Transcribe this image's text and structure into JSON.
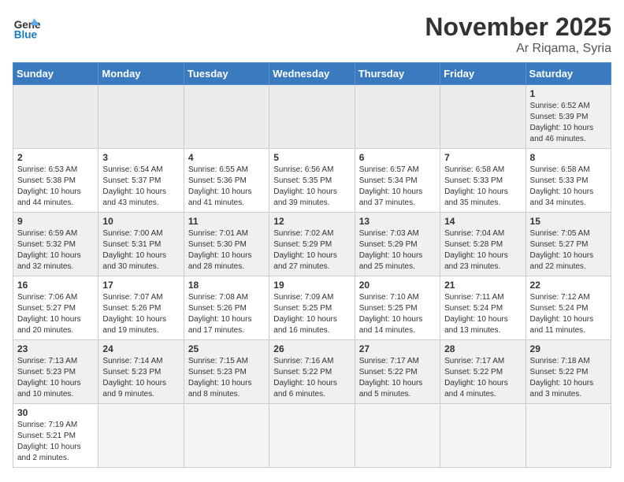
{
  "logo": {
    "text_general": "General",
    "text_blue": "Blue"
  },
  "title": "November 2025",
  "subtitle": "Ar Riqama, Syria",
  "weekdays": [
    "Sunday",
    "Monday",
    "Tuesday",
    "Wednesday",
    "Thursday",
    "Friday",
    "Saturday"
  ],
  "weeks": [
    [
      {
        "day": "",
        "info": ""
      },
      {
        "day": "",
        "info": ""
      },
      {
        "day": "",
        "info": ""
      },
      {
        "day": "",
        "info": ""
      },
      {
        "day": "",
        "info": ""
      },
      {
        "day": "",
        "info": ""
      },
      {
        "day": "1",
        "info": "Sunrise: 6:52 AM\nSunset: 5:39 PM\nDaylight: 10 hours and 46 minutes."
      }
    ],
    [
      {
        "day": "2",
        "info": "Sunrise: 6:53 AM\nSunset: 5:38 PM\nDaylight: 10 hours and 44 minutes."
      },
      {
        "day": "3",
        "info": "Sunrise: 6:54 AM\nSunset: 5:37 PM\nDaylight: 10 hours and 43 minutes."
      },
      {
        "day": "4",
        "info": "Sunrise: 6:55 AM\nSunset: 5:36 PM\nDaylight: 10 hours and 41 minutes."
      },
      {
        "day": "5",
        "info": "Sunrise: 6:56 AM\nSunset: 5:35 PM\nDaylight: 10 hours and 39 minutes."
      },
      {
        "day": "6",
        "info": "Sunrise: 6:57 AM\nSunset: 5:34 PM\nDaylight: 10 hours and 37 minutes."
      },
      {
        "day": "7",
        "info": "Sunrise: 6:58 AM\nSunset: 5:33 PM\nDaylight: 10 hours and 35 minutes."
      },
      {
        "day": "8",
        "info": "Sunrise: 6:58 AM\nSunset: 5:33 PM\nDaylight: 10 hours and 34 minutes."
      }
    ],
    [
      {
        "day": "9",
        "info": "Sunrise: 6:59 AM\nSunset: 5:32 PM\nDaylight: 10 hours and 32 minutes."
      },
      {
        "day": "10",
        "info": "Sunrise: 7:00 AM\nSunset: 5:31 PM\nDaylight: 10 hours and 30 minutes."
      },
      {
        "day": "11",
        "info": "Sunrise: 7:01 AM\nSunset: 5:30 PM\nDaylight: 10 hours and 28 minutes."
      },
      {
        "day": "12",
        "info": "Sunrise: 7:02 AM\nSunset: 5:29 PM\nDaylight: 10 hours and 27 minutes."
      },
      {
        "day": "13",
        "info": "Sunrise: 7:03 AM\nSunset: 5:29 PM\nDaylight: 10 hours and 25 minutes."
      },
      {
        "day": "14",
        "info": "Sunrise: 7:04 AM\nSunset: 5:28 PM\nDaylight: 10 hours and 23 minutes."
      },
      {
        "day": "15",
        "info": "Sunrise: 7:05 AM\nSunset: 5:27 PM\nDaylight: 10 hours and 22 minutes."
      }
    ],
    [
      {
        "day": "16",
        "info": "Sunrise: 7:06 AM\nSunset: 5:27 PM\nDaylight: 10 hours and 20 minutes."
      },
      {
        "day": "17",
        "info": "Sunrise: 7:07 AM\nSunset: 5:26 PM\nDaylight: 10 hours and 19 minutes."
      },
      {
        "day": "18",
        "info": "Sunrise: 7:08 AM\nSunset: 5:26 PM\nDaylight: 10 hours and 17 minutes."
      },
      {
        "day": "19",
        "info": "Sunrise: 7:09 AM\nSunset: 5:25 PM\nDaylight: 10 hours and 16 minutes."
      },
      {
        "day": "20",
        "info": "Sunrise: 7:10 AM\nSunset: 5:25 PM\nDaylight: 10 hours and 14 minutes."
      },
      {
        "day": "21",
        "info": "Sunrise: 7:11 AM\nSunset: 5:24 PM\nDaylight: 10 hours and 13 minutes."
      },
      {
        "day": "22",
        "info": "Sunrise: 7:12 AM\nSunset: 5:24 PM\nDaylight: 10 hours and 11 minutes."
      }
    ],
    [
      {
        "day": "23",
        "info": "Sunrise: 7:13 AM\nSunset: 5:23 PM\nDaylight: 10 hours and 10 minutes."
      },
      {
        "day": "24",
        "info": "Sunrise: 7:14 AM\nSunset: 5:23 PM\nDaylight: 10 hours and 9 minutes."
      },
      {
        "day": "25",
        "info": "Sunrise: 7:15 AM\nSunset: 5:23 PM\nDaylight: 10 hours and 8 minutes."
      },
      {
        "day": "26",
        "info": "Sunrise: 7:16 AM\nSunset: 5:22 PM\nDaylight: 10 hours and 6 minutes."
      },
      {
        "day": "27",
        "info": "Sunrise: 7:17 AM\nSunset: 5:22 PM\nDaylight: 10 hours and 5 minutes."
      },
      {
        "day": "28",
        "info": "Sunrise: 7:17 AM\nSunset: 5:22 PM\nDaylight: 10 hours and 4 minutes."
      },
      {
        "day": "29",
        "info": "Sunrise: 7:18 AM\nSunset: 5:22 PM\nDaylight: 10 hours and 3 minutes."
      }
    ],
    [
      {
        "day": "30",
        "info": "Sunrise: 7:19 AM\nSunset: 5:21 PM\nDaylight: 10 hours and 2 minutes."
      },
      {
        "day": "",
        "info": ""
      },
      {
        "day": "",
        "info": ""
      },
      {
        "day": "",
        "info": ""
      },
      {
        "day": "",
        "info": ""
      },
      {
        "day": "",
        "info": ""
      },
      {
        "day": "",
        "info": ""
      }
    ]
  ]
}
